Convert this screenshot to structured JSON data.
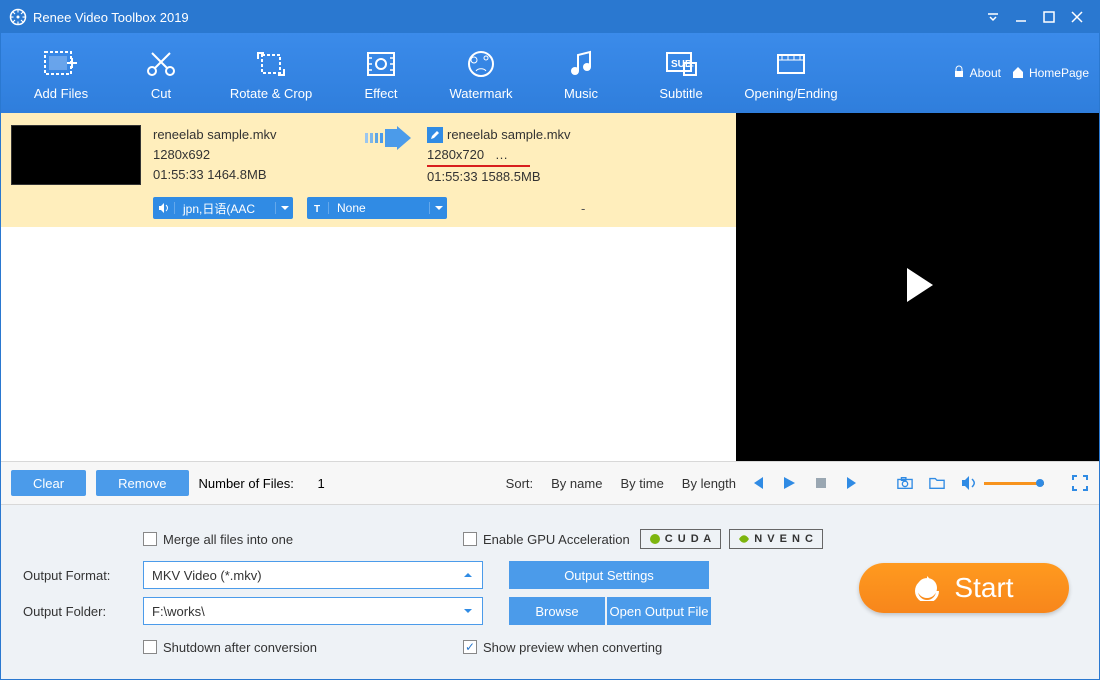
{
  "app_title": "Renee Video Toolbox 2019",
  "toolbar": [
    {
      "label": "Add Files"
    },
    {
      "label": "Cut"
    },
    {
      "label": "Rotate & Crop"
    },
    {
      "label": "Effect"
    },
    {
      "label": "Watermark"
    },
    {
      "label": "Music"
    },
    {
      "label": "Subtitle"
    },
    {
      "label": "Opening/Ending"
    }
  ],
  "rightlinks": {
    "about": "About",
    "home": "HomePage"
  },
  "file": {
    "src": {
      "name": "reneelab sample.mkv",
      "res": "1280x692",
      "dur": "01:55:33",
      "size": "1464.8MB"
    },
    "dst": {
      "name": "reneelab sample.mkv",
      "res": "1280x720",
      "res_suffix": "…",
      "dur": "01:55:33",
      "size": "1588.5MB"
    },
    "audio_track": "jpn,日语(AAC",
    "subtitle_track": "None",
    "extra": "-"
  },
  "actions": {
    "clear": "Clear",
    "remove": "Remove",
    "file_count_label": "Number of Files:",
    "file_count": "1",
    "sort_label": "Sort:",
    "sort_by_name": "By name",
    "sort_by_time": "By time",
    "sort_by_length": "By length"
  },
  "settings": {
    "merge": "Merge all files into one",
    "gpu": "Enable GPU Acceleration",
    "cuda": "C U D A",
    "nvenc": "N V E N C",
    "output_format_label": "Output Format:",
    "output_format_value": "MKV Video (*.mkv)",
    "output_settings": "Output Settings",
    "output_folder_label": "Output Folder:",
    "output_folder_value": "F:\\works\\",
    "browse": "Browse",
    "open_output": "Open Output File",
    "shutdown": "Shutdown after conversion",
    "show_preview": "Show preview when converting",
    "start": "Start"
  }
}
